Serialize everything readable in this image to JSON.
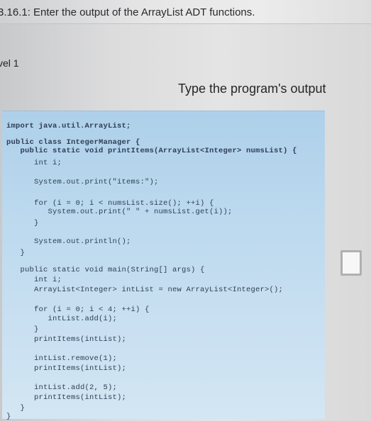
{
  "header": {
    "title": "3.16.1: Enter the output of the ArrayList ADT functions."
  },
  "level_label": "vel 1",
  "prompt_text": "Type the program's output",
  "code_lines": [
    "import java.util.ArrayList;",
    "public class IntegerManager {",
    "   public static void printItems(ArrayList<Integer> numsList) {",
    "      int i;",
    "      System.out.print(\"items:\");",
    "      for (i = 0; i < numsList.size(); ++i) {",
    "         System.out.print(\" \" + numsList.get(i));",
    "      }",
    "      System.out.println();",
    "   }",
    "   public static void main(String[] args) {",
    "      int i;",
    "      ArrayList<Integer> intList = new ArrayList<Integer>();",
    "      for (i = 0; i < 4; ++i) {",
    "         intList.add(i);",
    "      }",
    "      printItems(intList);",
    "      intList.remove(1);",
    "      printItems(intList);",
    "      intList.add(2, 5);",
    "      printItems(intList);",
    "   }",
    "}"
  ],
  "answer": {
    "value": ""
  }
}
